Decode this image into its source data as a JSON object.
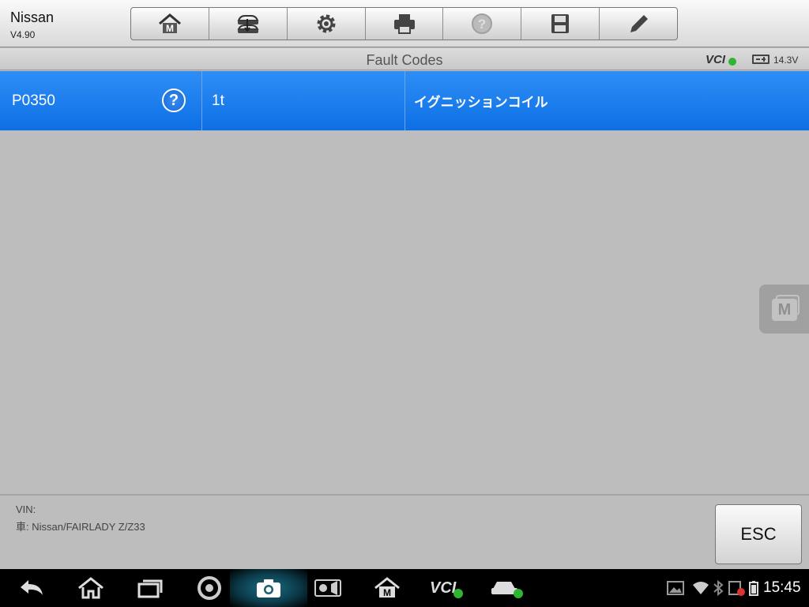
{
  "app": {
    "title": "Nissan",
    "version": "V4.90"
  },
  "toolbar": {
    "items": [
      {
        "name": "home",
        "icon": "home-m-icon"
      },
      {
        "name": "vehicle-swap",
        "icon": "car-swap-icon"
      },
      {
        "name": "settings",
        "icon": "gear-icon"
      },
      {
        "name": "print",
        "icon": "printer-icon"
      },
      {
        "name": "help",
        "icon": "help-icon",
        "disabled": true
      },
      {
        "name": "save",
        "icon": "floppy-disk-icon"
      },
      {
        "name": "edit",
        "icon": "pencil-icon"
      }
    ]
  },
  "subheader": {
    "title": "Fault Codes",
    "vci_label": "VCI",
    "voltage": "14.3V"
  },
  "fault_codes": [
    {
      "code": "P0350",
      "status": "1t",
      "description": "イグニッションコイル"
    }
  ],
  "bottom": {
    "vin_label": "VIN:",
    "vehicle_label": "車: Nissan/FAIRLADY Z/Z33",
    "esc_label": "ESC"
  },
  "navbar": {
    "buttons": [
      "back-icon",
      "home-icon",
      "recent-apps-icon",
      "chrome-icon",
      "camera-icon",
      "display-settings-icon",
      "maxisys-icon",
      "vci-icon",
      "car-icon"
    ],
    "time": "15:45"
  },
  "colors": {
    "selected_row": "#1577ea",
    "background": "#bdbdbd",
    "navbar": "#000000"
  }
}
